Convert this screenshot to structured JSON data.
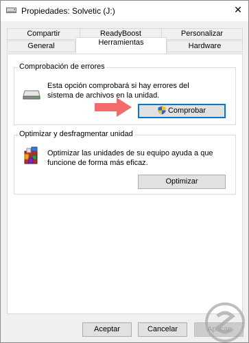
{
  "window": {
    "title": "Propiedades: Solvetic (J:)",
    "close_glyph": "✕"
  },
  "tabs": {
    "row1": [
      "Compartir",
      "ReadyBoost",
      "Personalizar"
    ],
    "row2": [
      "General",
      "Herramientas",
      "Hardware"
    ],
    "active": "Herramientas"
  },
  "error_check": {
    "title": "Comprobación de errores",
    "line1": "Esta opción comprobará si hay errores del",
    "line2": "sistema de archivos en la unidad.",
    "button": "Comprobar",
    "icon": "drive-icon"
  },
  "optimize": {
    "title": "Optimizar y desfragmentar unidad",
    "line1": "Optimizar las unidades de su equipo ayuda a que",
    "line2": "funcione de forma más eficaz.",
    "button": "Optimizar",
    "icon": "defrag-icon"
  },
  "footer": {
    "ok": "Aceptar",
    "cancel": "Cancelar",
    "apply": "Aplicar"
  },
  "colors": {
    "accent": "#0078d7",
    "arrow": "#f26a6a"
  }
}
